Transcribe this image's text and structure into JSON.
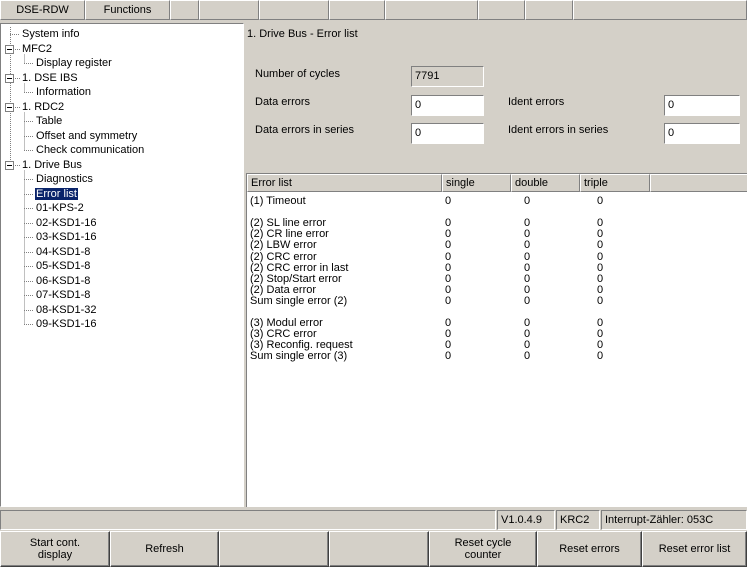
{
  "menubar": {
    "items": [
      "DSE-RDW",
      "Functions",
      "",
      "",
      "",
      "",
      "",
      "",
      "",
      ""
    ]
  },
  "tree": {
    "items": [
      {
        "label": "System info",
        "depth": 0,
        "expand": "none",
        "selected": false
      },
      {
        "label": "MFC2",
        "depth": 0,
        "expand": "minus",
        "selected": false
      },
      {
        "label": "Display register",
        "depth": 1,
        "expand": "none",
        "selected": false
      },
      {
        "label": "1. DSE IBS",
        "depth": 0,
        "expand": "minus",
        "selected": false
      },
      {
        "label": "Information",
        "depth": 1,
        "expand": "none",
        "selected": false
      },
      {
        "label": "1. RDC2",
        "depth": 0,
        "expand": "minus",
        "selected": false
      },
      {
        "label": "Table",
        "depth": 1,
        "expand": "none",
        "selected": false
      },
      {
        "label": "Offset and symmetry",
        "depth": 1,
        "expand": "none",
        "selected": false
      },
      {
        "label": "Check communication",
        "depth": 1,
        "expand": "none",
        "selected": false
      },
      {
        "label": "1. Drive Bus",
        "depth": 0,
        "expand": "minus",
        "selected": false
      },
      {
        "label": "Diagnostics",
        "depth": 1,
        "expand": "none",
        "selected": false
      },
      {
        "label": "Error list",
        "depth": 1,
        "expand": "none",
        "selected": true
      },
      {
        "label": "01-KPS-2",
        "depth": 1,
        "expand": "none",
        "selected": false
      },
      {
        "label": "02-KSD1-16",
        "depth": 1,
        "expand": "none",
        "selected": false
      },
      {
        "label": "03-KSD1-16",
        "depth": 1,
        "expand": "none",
        "selected": false
      },
      {
        "label": "04-KSD1-8",
        "depth": 1,
        "expand": "none",
        "selected": false
      },
      {
        "label": "05-KSD1-8",
        "depth": 1,
        "expand": "none",
        "selected": false
      },
      {
        "label": "06-KSD1-8",
        "depth": 1,
        "expand": "none",
        "selected": false
      },
      {
        "label": "07-KSD1-8",
        "depth": 1,
        "expand": "none",
        "selected": false
      },
      {
        "label": "08-KSD1-32",
        "depth": 1,
        "expand": "none",
        "selected": false
      },
      {
        "label": "09-KSD1-16",
        "depth": 1,
        "expand": "none",
        "selected": false
      }
    ]
  },
  "main": {
    "title": "1. Drive Bus - Error list",
    "number_of_cycles_label": "Number of cycles",
    "number_of_cycles_value": "7791",
    "data_errors_label": "Data errors",
    "data_errors_value": "0",
    "data_errors_series_label": "Data errors in series",
    "data_errors_series_value": "0",
    "ident_errors_label": "Ident errors",
    "ident_errors_value": "0",
    "ident_errors_series_label": "Ident errors in series",
    "ident_errors_series_value": "0"
  },
  "error_list": {
    "columns": [
      "Error list",
      "single",
      "double",
      "triple",
      ""
    ],
    "rows": [
      {
        "name": "(1) Timeout",
        "single": "0",
        "double": "0",
        "triple": "0"
      },
      {
        "name": "",
        "single": "",
        "double": "",
        "triple": ""
      },
      {
        "name": "(2) SL line error",
        "single": "0",
        "double": "0",
        "triple": "0"
      },
      {
        "name": "(2) CR line error",
        "single": "0",
        "double": "0",
        "triple": "0"
      },
      {
        "name": "(2) LBW error",
        "single": "0",
        "double": "0",
        "triple": "0"
      },
      {
        "name": "(2) CRC error",
        "single": "0",
        "double": "0",
        "triple": "0"
      },
      {
        "name": "(2) CRC error in last",
        "single": "0",
        "double": "0",
        "triple": "0"
      },
      {
        "name": "(2) Stop/Start error",
        "single": "0",
        "double": "0",
        "triple": "0"
      },
      {
        "name": "(2) Data error",
        "single": "0",
        "double": "0",
        "triple": "0"
      },
      {
        "name": "Sum single error (2)",
        "single": "0",
        "double": "0",
        "triple": "0"
      },
      {
        "name": "",
        "single": "",
        "double": "",
        "triple": ""
      },
      {
        "name": "(3) Modul error",
        "single": "0",
        "double": "0",
        "triple": "0"
      },
      {
        "name": "(3) CRC error",
        "single": "0",
        "double": "0",
        "triple": "0"
      },
      {
        "name": "(3) Reconfig. request",
        "single": "0",
        "double": "0",
        "triple": "0"
      },
      {
        "name": "Sum single error (3)",
        "single": "0",
        "double": "0",
        "triple": "0"
      }
    ]
  },
  "statusbar": {
    "cells": [
      "",
      "V1.0.4.9",
      "KRC2",
      "Interrupt-Zähler: 053C"
    ]
  },
  "buttons": [
    "Start cont.\ndisplay",
    "Refresh",
    "",
    "",
    "Reset cycle\ncounter",
    "Reset errors",
    "Reset error list"
  ]
}
